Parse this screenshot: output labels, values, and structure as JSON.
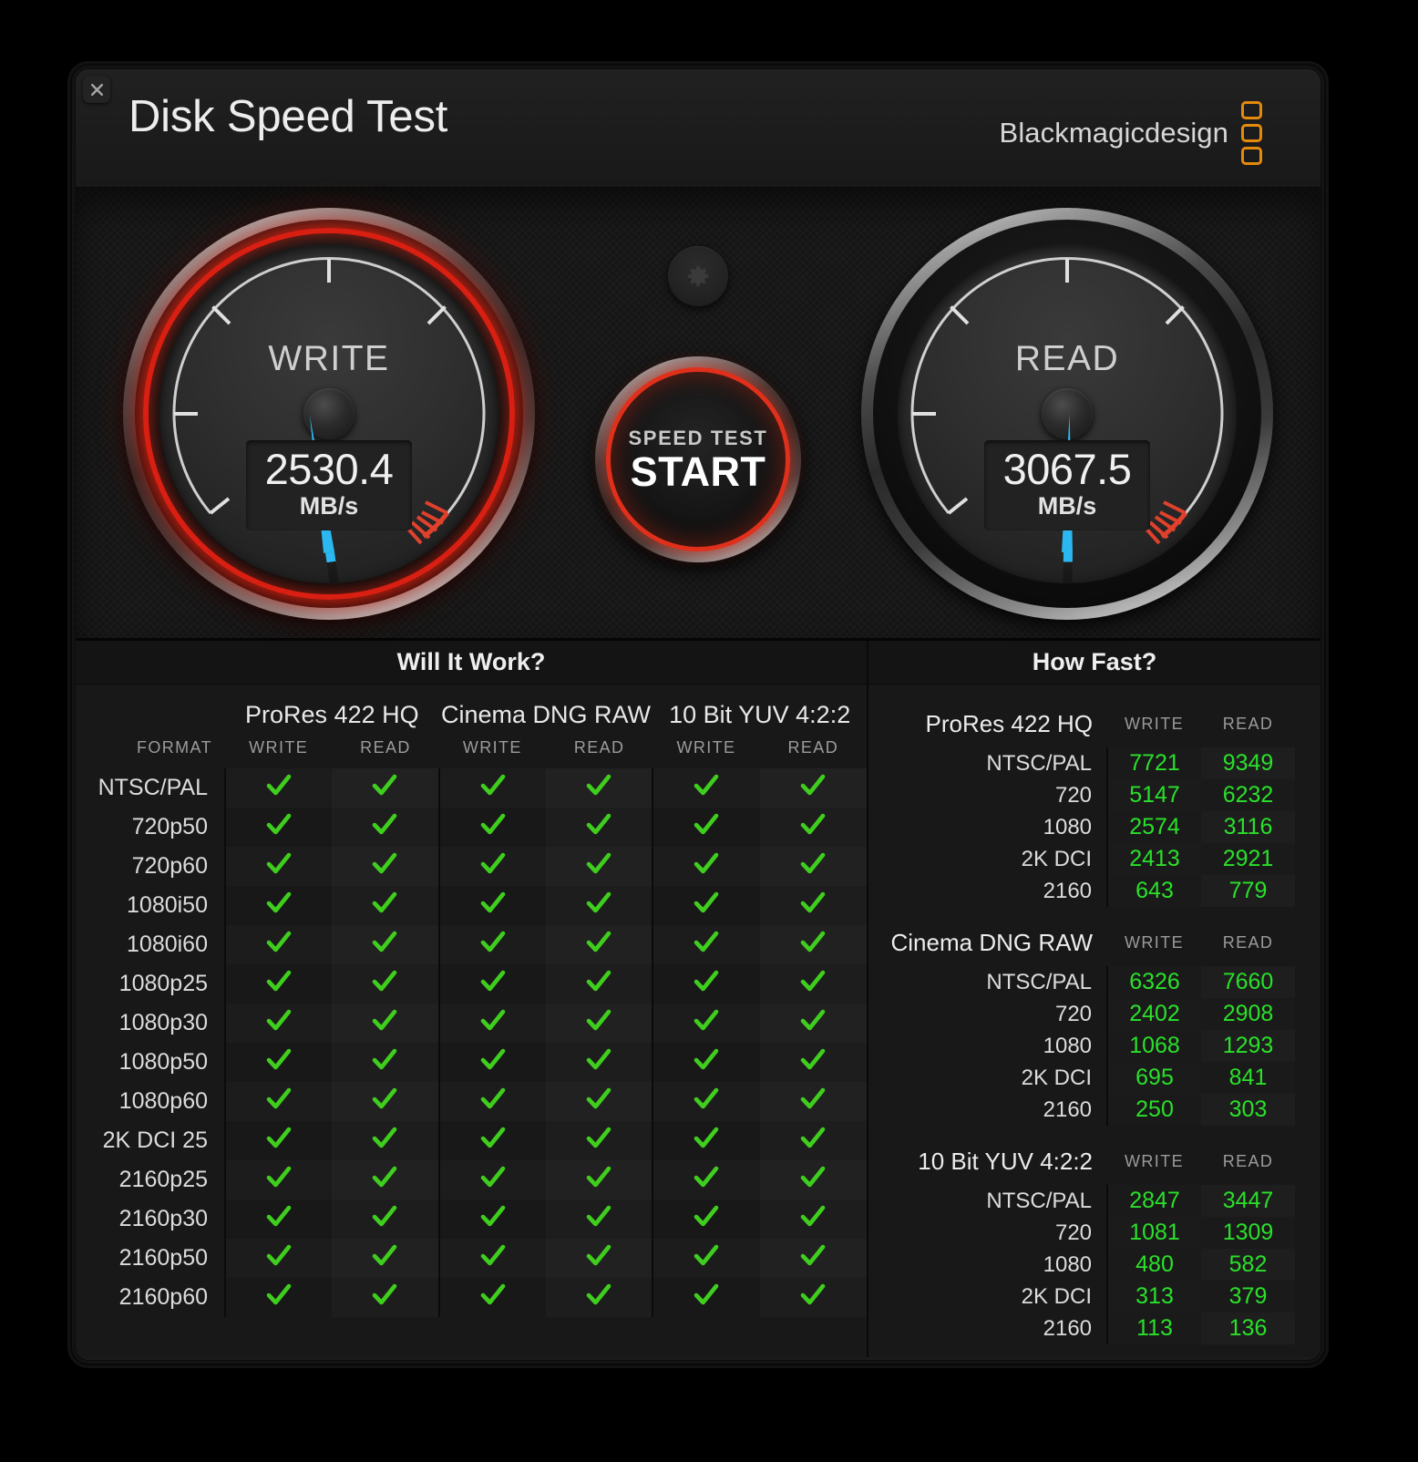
{
  "window": {
    "title": "Disk Speed Test",
    "close_label": "x",
    "brand": "Blackmagicdesign"
  },
  "gauges": {
    "write": {
      "label": "WRITE",
      "value": "2530.4",
      "unit": "MB/s",
      "needle_angle_deg": -8,
      "glow": true
    },
    "read": {
      "label": "READ",
      "value": "3067.5",
      "unit": "MB/s",
      "needle_angle_deg": 1,
      "glow": false
    }
  },
  "controls": {
    "settings_icon": "gear-icon",
    "start_small": "SPEED TEST",
    "start_big": "START"
  },
  "will_it_work": {
    "title": "Will It Work?",
    "format_header": "FORMAT",
    "groups": [
      "ProRes 422 HQ",
      "Cinema DNG RAW",
      "10 Bit YUV 4:2:2"
    ],
    "sub_headers": [
      "WRITE",
      "READ"
    ],
    "check_symbol": "check-icon",
    "check_color": "#3fce1e",
    "rows": [
      {
        "format": "NTSC/PAL",
        "cells": [
          true,
          true,
          true,
          true,
          true,
          true
        ]
      },
      {
        "format": "720p50",
        "cells": [
          true,
          true,
          true,
          true,
          true,
          true
        ]
      },
      {
        "format": "720p60",
        "cells": [
          true,
          true,
          true,
          true,
          true,
          true
        ]
      },
      {
        "format": "1080i50",
        "cells": [
          true,
          true,
          true,
          true,
          true,
          true
        ]
      },
      {
        "format": "1080i60",
        "cells": [
          true,
          true,
          true,
          true,
          true,
          true
        ]
      },
      {
        "format": "1080p25",
        "cells": [
          true,
          true,
          true,
          true,
          true,
          true
        ]
      },
      {
        "format": "1080p30",
        "cells": [
          true,
          true,
          true,
          true,
          true,
          true
        ]
      },
      {
        "format": "1080p50",
        "cells": [
          true,
          true,
          true,
          true,
          true,
          true
        ]
      },
      {
        "format": "1080p60",
        "cells": [
          true,
          true,
          true,
          true,
          true,
          true
        ]
      },
      {
        "format": "2K DCI 25",
        "cells": [
          true,
          true,
          true,
          true,
          true,
          true
        ]
      },
      {
        "format": "2160p25",
        "cells": [
          true,
          true,
          true,
          true,
          true,
          true
        ]
      },
      {
        "format": "2160p30",
        "cells": [
          true,
          true,
          true,
          true,
          true,
          true
        ]
      },
      {
        "format": "2160p50",
        "cells": [
          true,
          true,
          true,
          true,
          true,
          true
        ]
      },
      {
        "format": "2160p60",
        "cells": [
          true,
          true,
          true,
          true,
          true,
          true
        ]
      }
    ]
  },
  "how_fast": {
    "title": "How Fast?",
    "col_headers": [
      "WRITE",
      "READ"
    ],
    "groups": [
      {
        "name": "ProRes 422 HQ",
        "rows": [
          {
            "label": "NTSC/PAL",
            "write": "7721",
            "read": "9349"
          },
          {
            "label": "720",
            "write": "5147",
            "read": "6232"
          },
          {
            "label": "1080",
            "write": "2574",
            "read": "3116"
          },
          {
            "label": "2K DCI",
            "write": "2413",
            "read": "2921"
          },
          {
            "label": "2160",
            "write": "643",
            "read": "779"
          }
        ]
      },
      {
        "name": "Cinema DNG RAW",
        "rows": [
          {
            "label": "NTSC/PAL",
            "write": "6326",
            "read": "7660"
          },
          {
            "label": "720",
            "write": "2402",
            "read": "2908"
          },
          {
            "label": "1080",
            "write": "1068",
            "read": "1293"
          },
          {
            "label": "2K DCI",
            "write": "695",
            "read": "841"
          },
          {
            "label": "2160",
            "write": "250",
            "read": "303"
          }
        ]
      },
      {
        "name": "10 Bit YUV 4:2:2",
        "rows": [
          {
            "label": "NTSC/PAL",
            "write": "2847",
            "read": "3447"
          },
          {
            "label": "720",
            "write": "1081",
            "read": "1309"
          },
          {
            "label": "1080",
            "write": "480",
            "read": "582"
          },
          {
            "label": "2K DCI",
            "write": "313",
            "read": "379"
          },
          {
            "label": "2160",
            "write": "113",
            "read": "136"
          }
        ]
      }
    ]
  },
  "colors": {
    "accent_red": "#e0301b",
    "needle_blue": "#2bb8f0",
    "value_green": "#2ae02a",
    "brand_orange": "#e58a0c"
  }
}
